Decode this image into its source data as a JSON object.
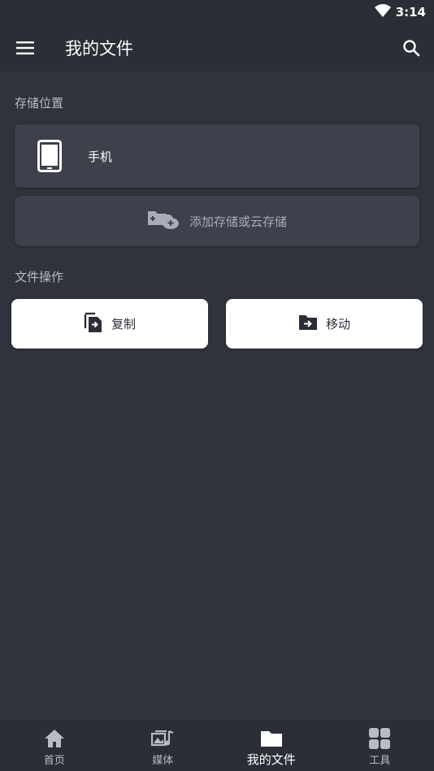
{
  "status_bar": {
    "time": "3:14"
  },
  "app_bar": {
    "title": "我的文件"
  },
  "storage_section": {
    "title": "存储位置",
    "items": [
      {
        "label": "手机",
        "icon": "tablet-icon"
      }
    ],
    "add_label": "添加存储或云存储"
  },
  "file_ops_section": {
    "title": "文件操作",
    "copy_label": "复制",
    "move_label": "移动"
  },
  "bottom_nav": {
    "items": [
      {
        "label": "首页",
        "icon": "home-icon"
      },
      {
        "label": "媒体",
        "icon": "media-icon"
      },
      {
        "label": "我的文件",
        "icon": "folder-icon"
      },
      {
        "label": "工具",
        "icon": "apps-grid-icon"
      }
    ],
    "active_index": 2
  },
  "colors": {
    "background": "#30333c",
    "bar": "#2b2e36",
    "card": "#3e414b",
    "button": "#ffffff",
    "muted_text": "#b8bcc6"
  }
}
